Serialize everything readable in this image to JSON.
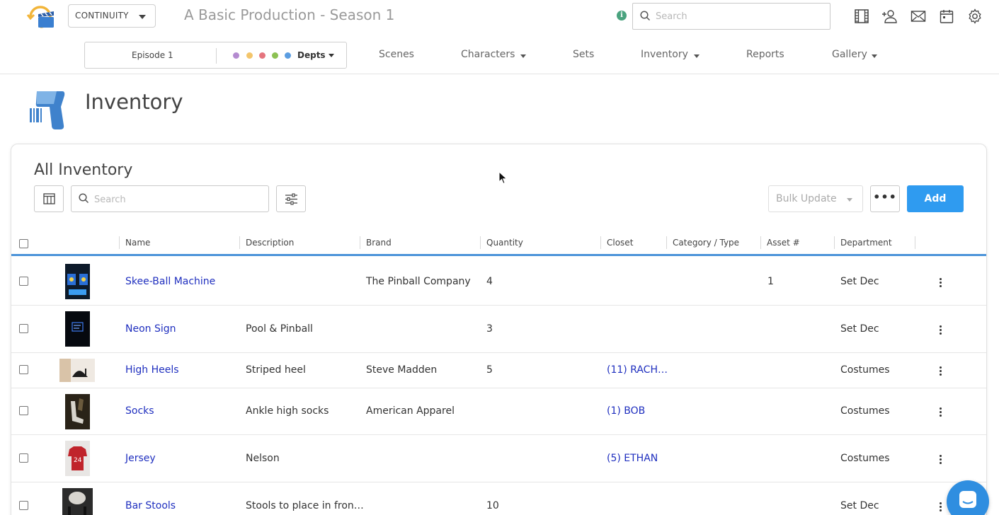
{
  "header": {
    "project_select": "CONTINUITY",
    "app_title": "A Basic Production - Season 1",
    "search_placeholder": "Search",
    "icons": [
      "film-strip-icon",
      "add-user-icon",
      "mail-icon",
      "calendar-icon",
      "gear-icon"
    ]
  },
  "nav": {
    "episode": "Episode 1",
    "depts_label": "Depts",
    "dept_colors": [
      "#b48bd0",
      "#f3c56b",
      "#e5747e",
      "#8cc152",
      "#5b9de1"
    ],
    "items": [
      {
        "label": "Scenes",
        "dropdown": false
      },
      {
        "label": "Characters",
        "dropdown": true
      },
      {
        "label": "Sets",
        "dropdown": false
      },
      {
        "label": "Inventory",
        "dropdown": true
      },
      {
        "label": "Reports",
        "dropdown": false
      },
      {
        "label": "Gallery",
        "dropdown": true
      }
    ]
  },
  "page": {
    "title": "Inventory",
    "icon": "barcode-scanner-icon"
  },
  "card": {
    "title": "All Inventory",
    "search_placeholder": "Search",
    "bulk_update_label": "Bulk Update",
    "more_label": "•••",
    "add_label": "Add"
  },
  "table": {
    "columns": [
      "Name",
      "Description",
      "Brand",
      "Quantity",
      "Closet",
      "Category / Type",
      "Asset #",
      "Department"
    ],
    "rows": [
      {
        "name": "Skee-Ball Machine",
        "description": "",
        "brand": "The Pinball Company",
        "quantity": "4",
        "closet": "",
        "category": "",
        "asset": "1",
        "department": "Set Dec"
      },
      {
        "name": "Neon Sign",
        "description": "Pool & Pinball",
        "brand": "",
        "quantity": "3",
        "closet": "",
        "category": "",
        "asset": "",
        "department": "Set Dec"
      },
      {
        "name": "High Heels",
        "description": "Striped heel",
        "brand": "Steve Madden",
        "quantity": "5",
        "closet": "(11) RACH…",
        "category": "",
        "asset": "",
        "department": "Costumes"
      },
      {
        "name": "Socks",
        "description": "Ankle high socks",
        "brand": "American Apparel",
        "quantity": "",
        "closet": "(1) BOB",
        "category": "",
        "asset": "",
        "department": "Costumes"
      },
      {
        "name": "Jersey",
        "description": "Nelson",
        "brand": "",
        "quantity": "",
        "closet": "(5) ETHAN",
        "category": "",
        "asset": "",
        "department": "Costumes"
      },
      {
        "name": "Bar Stools",
        "description": "Stools to place in fron…",
        "brand": "",
        "quantity": "10",
        "closet": "",
        "category": "",
        "asset": "",
        "department": "Set Dec"
      }
    ]
  },
  "colors": {
    "accent": "#2f9bf0",
    "link": "#1f2fbf",
    "header_underline": "#4b93d9"
  }
}
